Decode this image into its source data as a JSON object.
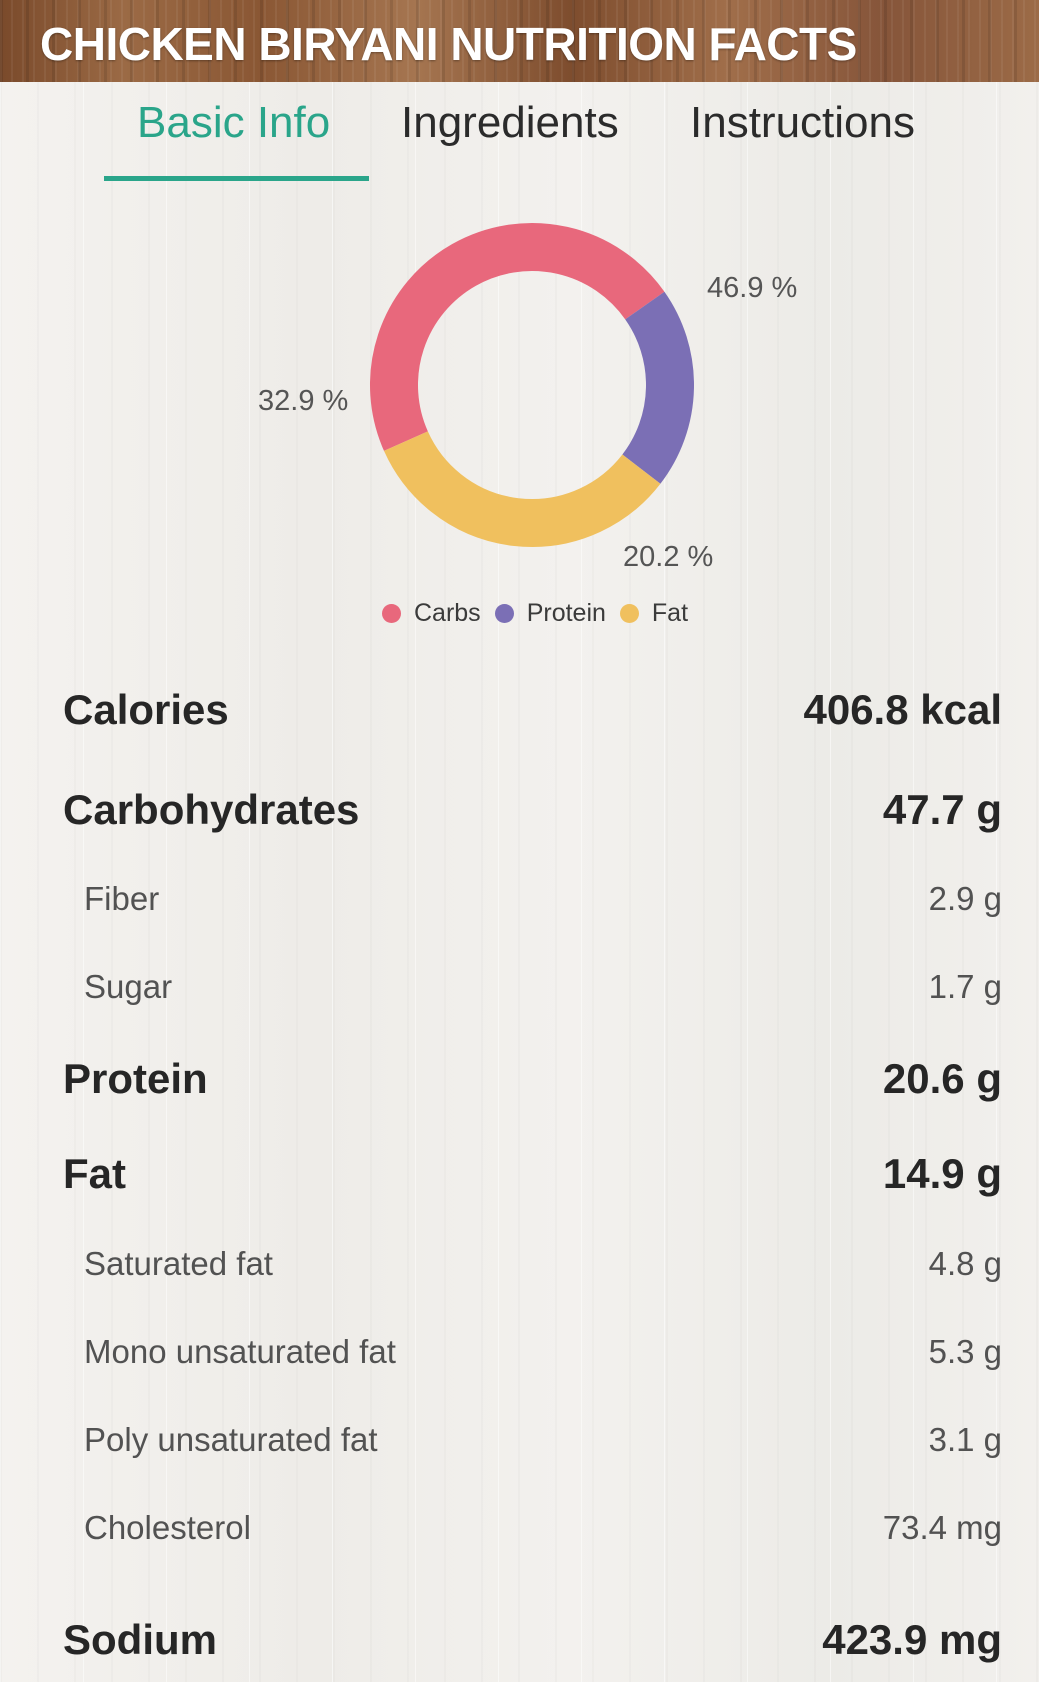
{
  "header": {
    "title": "CHICKEN BIRYANI NUTRITION FACTS"
  },
  "tabs": [
    {
      "label": "Basic Info",
      "active": true
    },
    {
      "label": "Ingredients",
      "active": false
    },
    {
      "label": "Instructions",
      "active": false
    }
  ],
  "chart_data": {
    "type": "pie",
    "style": "donut",
    "categories": [
      "Carbs",
      "Protein",
      "Fat"
    ],
    "values": [
      46.9,
      20.2,
      32.9
    ],
    "labels": [
      "46.9 %",
      "20.2 %",
      "32.9 %"
    ],
    "colors": [
      "#e8687c",
      "#7b6fb5",
      "#f0c05e"
    ],
    "legend": "bottom"
  },
  "nutrition": {
    "calories": {
      "label": "Calories",
      "value": "406.8 kcal"
    },
    "carbohydrates": {
      "label": "Carbohydrates",
      "value": "47.7 g"
    },
    "fiber": {
      "label": "Fiber",
      "value": "2.9 g"
    },
    "sugar": {
      "label": "Sugar",
      "value": "1.7 g"
    },
    "protein": {
      "label": "Protein",
      "value": "20.6 g"
    },
    "fat": {
      "label": "Fat",
      "value": "14.9 g"
    },
    "saturated_fat": {
      "label": "Saturated fat",
      "value": "4.8 g"
    },
    "mono_fat": {
      "label": "Mono unsaturated fat",
      "value": "5.3 g"
    },
    "poly_fat": {
      "label": "Poly unsaturated fat",
      "value": "3.1 g"
    },
    "cholesterol": {
      "label": "Cholesterol",
      "value": "73.4 mg"
    },
    "sodium": {
      "label": "Sodium",
      "value": "423.9 mg"
    }
  }
}
